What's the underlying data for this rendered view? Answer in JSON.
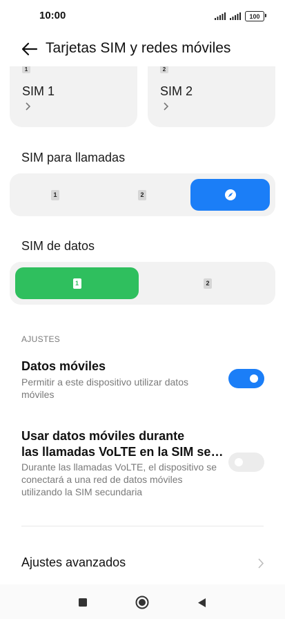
{
  "status_bar": {
    "time": "10:00",
    "battery": "100",
    "icons": [
      "signal-icon",
      "signal-icon",
      "battery-icon"
    ]
  },
  "header": {
    "title": "Tarjetas SIM y redes móviles",
    "back_icon": "back-arrow-icon"
  },
  "sim_cards": [
    {
      "chip": "1",
      "name": "SIM 1"
    },
    {
      "chip": "2",
      "name": "SIM 2"
    }
  ],
  "calls": {
    "label": "SIM para llamadas",
    "options": [
      {
        "chip": "1"
      },
      {
        "chip": "2"
      },
      {
        "icon": "compass-icon"
      }
    ],
    "selected_index": 2
  },
  "data_sim": {
    "label": "SIM de datos",
    "options": [
      {
        "chip": "1"
      },
      {
        "chip": "2"
      }
    ],
    "selected_index": 0
  },
  "settings": {
    "section_label": "AJUSTES",
    "mobile_data": {
      "title": "Datos móviles",
      "description": "Permitir a este dispositivo utilizar datos móviles",
      "enabled": true
    },
    "volte_data": {
      "title_line1": "Usar datos móviles durante",
      "title_line2": "las llamadas VoLTE en la SIM se…",
      "description": "Durante las llamadas VoLTE, el dispositivo se conectará a una red de datos móviles utilizando la SIM secundaria",
      "enabled": false
    },
    "advanced": {
      "label": "Ajustes avanzados"
    }
  },
  "nav_bar": {
    "buttons": [
      "recents-square-icon",
      "home-circle-icon",
      "back-triangle-icon"
    ]
  },
  "colors": {
    "accent_blue": "#1b7ef7",
    "accent_green": "#2fbf5e",
    "surface": "#f2f2f2"
  }
}
